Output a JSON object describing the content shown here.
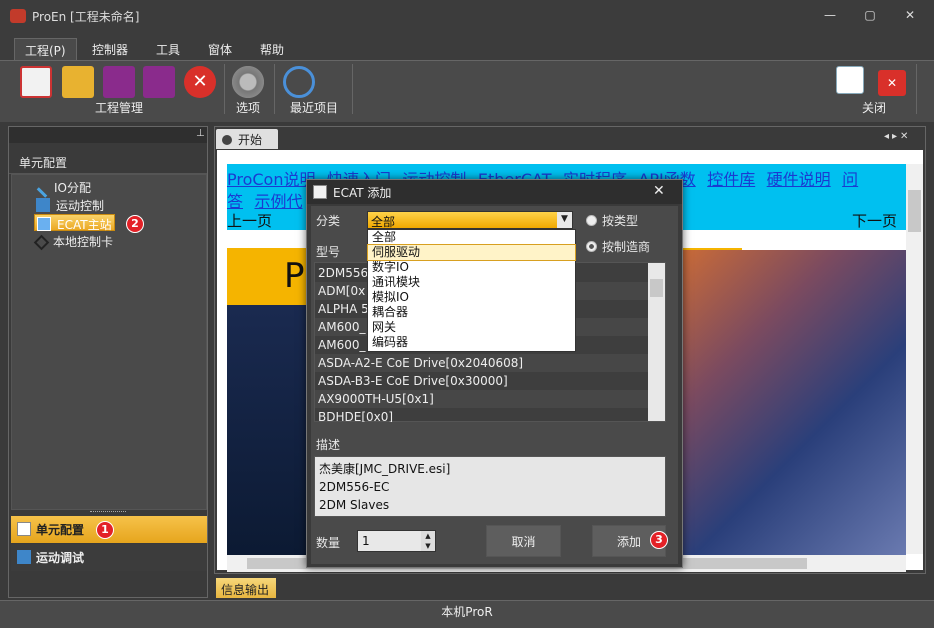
{
  "window": {
    "title": "ProEn [工程未命名]",
    "min": "—",
    "max": "▢",
    "close": "✕"
  },
  "menu": [
    "工程(P)",
    "控制器",
    "工具",
    "窗体",
    "帮助"
  ],
  "ribbon": {
    "group1": "工程管理",
    "options": "选项",
    "recent": "最近项目",
    "close": "关闭"
  },
  "leftpanel": {
    "pin": "⊥",
    "header": "单元配置",
    "tree": [
      "IO分配",
      "运动控制",
      "ECAT主站",
      "本地控制卡"
    ],
    "bottom1": "单元配置",
    "bottom2": "运动调试",
    "badge1": "1",
    "badge2": "2"
  },
  "tabs": {
    "start": "开始"
  },
  "browser": {
    "links_row1": [
      "ProCon说明",
      "快速入门",
      "运动控制",
      "EtherCAT",
      "实时程序",
      "API函数",
      "控件库",
      "硬件说明",
      "问"
    ],
    "links_row2": [
      "答",
      "示例代"
    ],
    "prev": "上一页",
    "next": "下一页",
    "hero_letter": "P"
  },
  "dialog": {
    "title": "ECAT 添加",
    "close": "✕",
    "category_label": "分类",
    "category_value": "全部",
    "radio_type": "按类型",
    "radio_vendor": "按制造商",
    "model_label": "型号",
    "dropdown": [
      "全部",
      "伺服驱动",
      "数字IO",
      "通讯模块",
      "模拟IO",
      "耦合器",
      "网关",
      "编码器"
    ],
    "models": [
      "2DM556",
      "ADM[0x",
      "ALPHA 5",
      "AM600_",
      "AM600_",
      "ASDA-A2-E CoE Drive[0x2040608]",
      "ASDA-B3-E CoE Drive[0x30000]",
      "AX9000TH-U5[0x1]",
      "BDHDE[0x0]"
    ],
    "desc_label": "描述",
    "desc_lines": [
      "杰美康[JMC_DRIVE.esi]",
      "2DM556-EC",
      "2DM Slaves"
    ],
    "qty_label": "数量",
    "qty_value": "1",
    "cancel": "取消",
    "add": "添加",
    "badge3": "3"
  },
  "infotab": "信息输出",
  "status": "本机ProR"
}
